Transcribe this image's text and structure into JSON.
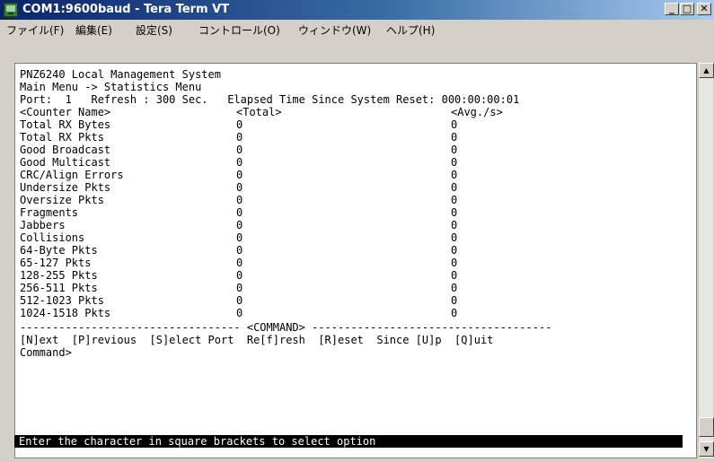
{
  "window": {
    "title": "COM1:9600baud - Tera Term VT",
    "minimize_label": "_",
    "maximize_label": "□",
    "close_label": "✕"
  },
  "menu": [
    "ファイル(F)",
    "編集(E)",
    "設定(S)",
    "コントロール(O)",
    "ウィンドウ(W)",
    "ヘルプ(H)"
  ],
  "terminal": {
    "line1": "PNZ6240 Local Management System",
    "line2": "Main Menu -> Statistics Menu",
    "line3": "Port:  1   Refresh : 300 Sec.   Elapsed Time Since System Reset: 000:00:00:01",
    "headers": {
      "name": "<Counter Name>",
      "total": "<Total>",
      "avg": "<Avg./s>"
    },
    "counters": [
      {
        "name": "Total RX Bytes",
        "total": "0",
        "avg": "0"
      },
      {
        "name": "Total RX Pkts",
        "total": "0",
        "avg": "0"
      },
      {
        "name": "Good Broadcast",
        "total": "0",
        "avg": "0"
      },
      {
        "name": "Good Multicast",
        "total": "0",
        "avg": "0"
      },
      {
        "name": "CRC/Align Errors",
        "total": "0",
        "avg": "0"
      },
      {
        "name": "Undersize Pkts",
        "total": "0",
        "avg": "0"
      },
      {
        "name": "Oversize Pkts",
        "total": "0",
        "avg": "0"
      },
      {
        "name": "Fragments",
        "total": "0",
        "avg": "0"
      },
      {
        "name": "Jabbers",
        "total": "0",
        "avg": "0"
      },
      {
        "name": "Collisions",
        "total": "0",
        "avg": "0"
      },
      {
        "name": "64-Byte Pkts",
        "total": "0",
        "avg": "0"
      },
      {
        "name": "65-127 Pkts",
        "total": "0",
        "avg": "0"
      },
      {
        "name": "128-255 Pkts",
        "total": "0",
        "avg": "0"
      },
      {
        "name": "256-511 Pkts",
        "total": "0",
        "avg": "0"
      },
      {
        "name": "512-1023 Pkts",
        "total": "0",
        "avg": "0"
      },
      {
        "name": "1024-1518 Pkts",
        "total": "0",
        "avg": "0"
      }
    ],
    "command_divider": "---------------------------------- <COMMAND> -------------------------------------",
    "commands": "[N]ext  [P]revious  [S]elect Port  Re[f]resh  [R]eset  Since [U]p  [Q]uit",
    "prompt": "Command>",
    "status": "Enter the character in square brackets to select option"
  },
  "colors": {
    "title_gradient_start": "#0a246a",
    "title_gradient_end": "#a6caf0",
    "terminal_bg": "#ffffff",
    "terminal_fg": "#000000",
    "status_bg": "#000000",
    "status_fg": "#ffffff"
  }
}
